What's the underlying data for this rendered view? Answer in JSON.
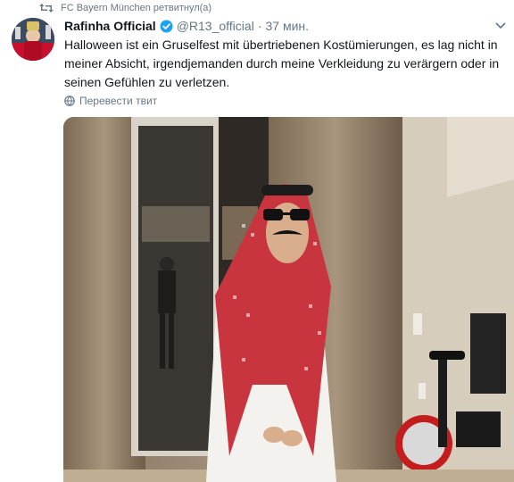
{
  "retweet": {
    "label": "FC Bayern München ретвитнул(а)",
    "icon": "retweet-icon"
  },
  "tweet": {
    "author_name": "Rafinha Official",
    "handle": "@R13_official",
    "separator": "·",
    "time": "37 мин.",
    "text": "Halloween ist ein Gruselfest mit übertriebenen Kostümierungen, es lag nicht in meiner Absicht, irgendjemanden durch meine Verkleidung zu verärgern oder in seinen Gefühlen zu verletzen.",
    "translate_label": "Перевести твит"
  },
  "colors": {
    "accent": "#1da1f2",
    "muted": "#657786",
    "text": "#14171a"
  }
}
